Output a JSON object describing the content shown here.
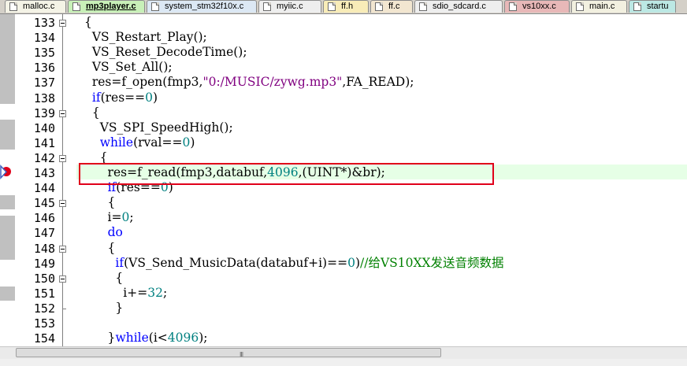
{
  "tabs": [
    {
      "label": "malloc.c",
      "color": "#f4f3e6",
      "active": false
    },
    {
      "label": "mp3player.c",
      "color": "#c8f0b8",
      "active": true
    },
    {
      "label": "system_stm32f10x.c",
      "color": "#dce8f4",
      "active": false
    },
    {
      "label": "myiic.c",
      "color": "#eeeeee",
      "active": false
    },
    {
      "label": "ff.h",
      "color": "#f8ecb8",
      "active": false
    },
    {
      "label": "ff.c",
      "color": "#f2e6d0",
      "active": false
    },
    {
      "label": "sdio_sdcard.c",
      "color": "#eeeeee",
      "active": false
    },
    {
      "label": "vs10xx.c",
      "color": "#e8b8b8",
      "active": false
    },
    {
      "label": "main.c",
      "color": "#f2f0e0",
      "active": false
    },
    {
      "label": "startu",
      "color": "#bce8e4",
      "active": false
    }
  ],
  "editor": {
    "current_line": "143",
    "lines": [
      {
        "no": "133",
        "tokens": [
          {
            "t": "{",
            "c": ""
          }
        ]
      },
      {
        "no": "134",
        "tokens": [
          {
            "t": "  VS_Restart_Play();",
            "c": ""
          }
        ]
      },
      {
        "no": "135",
        "tokens": [
          {
            "t": "  VS_Reset_DecodeTime();",
            "c": ""
          }
        ]
      },
      {
        "no": "136",
        "tokens": [
          {
            "t": "  VS_Set_All();",
            "c": ""
          }
        ]
      },
      {
        "no": "137",
        "tokens": [
          {
            "t": "  res=f_open(fmp3,",
            "c": ""
          },
          {
            "t": "\"0:/MUSIC/zywg.mp3\"",
            "c": "str"
          },
          {
            "t": ",FA_READ);",
            "c": ""
          }
        ]
      },
      {
        "no": "138",
        "tokens": [
          {
            "t": "  ",
            "c": ""
          },
          {
            "t": "if",
            "c": "kw"
          },
          {
            "t": "(res==",
            "c": ""
          },
          {
            "t": "0",
            "c": "num"
          },
          {
            "t": ")",
            "c": ""
          }
        ]
      },
      {
        "no": "139",
        "tokens": [
          {
            "t": "  {",
            "c": ""
          }
        ]
      },
      {
        "no": "140",
        "tokens": [
          {
            "t": "    VS_SPI_SpeedHigh();",
            "c": ""
          }
        ]
      },
      {
        "no": "141",
        "tokens": [
          {
            "t": "    ",
            "c": ""
          },
          {
            "t": "while",
            "c": "kw"
          },
          {
            "t": "(rval==",
            "c": ""
          },
          {
            "t": "0",
            "c": "num"
          },
          {
            "t": ")",
            "c": ""
          }
        ]
      },
      {
        "no": "142",
        "tokens": [
          {
            "t": "    {",
            "c": ""
          }
        ]
      },
      {
        "no": "143",
        "tokens": [
          {
            "t": "      res=f_read(fmp3,databuf,",
            "c": ""
          },
          {
            "t": "4096",
            "c": "num"
          },
          {
            "t": ",(UINT*)&br);",
            "c": ""
          }
        ]
      },
      {
        "no": "144",
        "tokens": [
          {
            "t": "      ",
            "c": ""
          },
          {
            "t": "if",
            "c": "kw"
          },
          {
            "t": "(res==",
            "c": ""
          },
          {
            "t": "0",
            "c": "num"
          },
          {
            "t": ")",
            "c": ""
          }
        ]
      },
      {
        "no": "145",
        "tokens": [
          {
            "t": "      {",
            "c": ""
          }
        ]
      },
      {
        "no": "146",
        "tokens": [
          {
            "t": "      i=",
            "c": ""
          },
          {
            "t": "0",
            "c": "num"
          },
          {
            "t": ";",
            "c": ""
          }
        ]
      },
      {
        "no": "147",
        "tokens": [
          {
            "t": "      ",
            "c": ""
          },
          {
            "t": "do",
            "c": "kw"
          }
        ]
      },
      {
        "no": "148",
        "tokens": [
          {
            "t": "      {",
            "c": ""
          }
        ]
      },
      {
        "no": "149",
        "tokens": [
          {
            "t": "        ",
            "c": ""
          },
          {
            "t": "if",
            "c": "kw"
          },
          {
            "t": "(VS_Send_MusicData(databuf+i)==",
            "c": ""
          },
          {
            "t": "0",
            "c": "num"
          },
          {
            "t": ")",
            "c": ""
          },
          {
            "t": "//给VS10XX发送音频数据",
            "c": "cm"
          }
        ]
      },
      {
        "no": "150",
        "tokens": [
          {
            "t": "        {",
            "c": ""
          }
        ]
      },
      {
        "no": "151",
        "tokens": [
          {
            "t": "          i+=",
            "c": ""
          },
          {
            "t": "32",
            "c": "num"
          },
          {
            "t": ";",
            "c": ""
          }
        ]
      },
      {
        "no": "152",
        "tokens": [
          {
            "t": "        }",
            "c": ""
          }
        ]
      },
      {
        "no": "153",
        "tokens": [
          {
            "t": "",
            "c": ""
          }
        ]
      },
      {
        "no": "154",
        "tokens": [
          {
            "t": "      }",
            "c": ""
          },
          {
            "t": "while",
            "c": "kw"
          },
          {
            "t": "(i<",
            "c": ""
          },
          {
            "t": "4096",
            "c": "num"
          },
          {
            "t": ");",
            "c": ""
          }
        ]
      }
    ]
  },
  "scrollbar": {
    "grip": "III"
  },
  "colors": {
    "highlight_box": "#e0001a",
    "current_line_bg": "#e6ffe6",
    "keyword": "#0000ff",
    "number": "#008080",
    "string": "#800080",
    "comment": "#008000"
  }
}
